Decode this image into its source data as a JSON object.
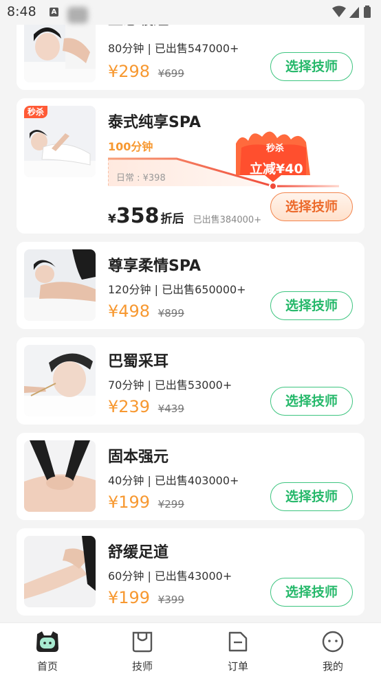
{
  "status_bar": {
    "time": "8:48",
    "notif_letter": "A"
  },
  "colors": {
    "accent_green": "#25b86a",
    "price_orange": "#f79830",
    "flash_red": "#ff5a36"
  },
  "services": [
    {
      "name": "至息暖蕴SPA",
      "meta": "80分钟 | 已出售547000+",
      "price": "¥298",
      "original": "¥699",
      "button": "选择技师"
    },
    {
      "name": "泰式纯享SPA",
      "badge": "秒杀",
      "duration": "100分钟",
      "daily_price": "日常 : ¥398",
      "flash_label": "秒杀",
      "flash_discount": "立减¥40",
      "final_currency": "¥",
      "final_amount": "358",
      "final_suffix": "折后",
      "sold": "已出售384000+",
      "button": "选择技师"
    },
    {
      "name": "尊享柔情SPA",
      "meta": "120分钟 | 已出售650000+",
      "price": "¥498",
      "original": "¥899",
      "button": "选择技师"
    },
    {
      "name": "巴蜀采耳",
      "meta": "70分钟 | 已出售53000+",
      "price": "¥239",
      "original": "¥439",
      "button": "选择技师"
    },
    {
      "name": "固本强元",
      "meta": "40分钟 | 已出售403000+",
      "price": "¥199",
      "original": "¥299",
      "button": "选择技师"
    },
    {
      "name": "舒缓足道",
      "meta": "60分钟 | 已出售43000+",
      "price": "¥199",
      "original": "¥399",
      "button": "选择技师"
    }
  ],
  "nav": [
    {
      "label": "首页",
      "icon": "home-mascot-icon",
      "active": true
    },
    {
      "label": "技师",
      "icon": "technician-icon"
    },
    {
      "label": "订单",
      "icon": "order-icon"
    },
    {
      "label": "我的",
      "icon": "profile-icon"
    }
  ]
}
